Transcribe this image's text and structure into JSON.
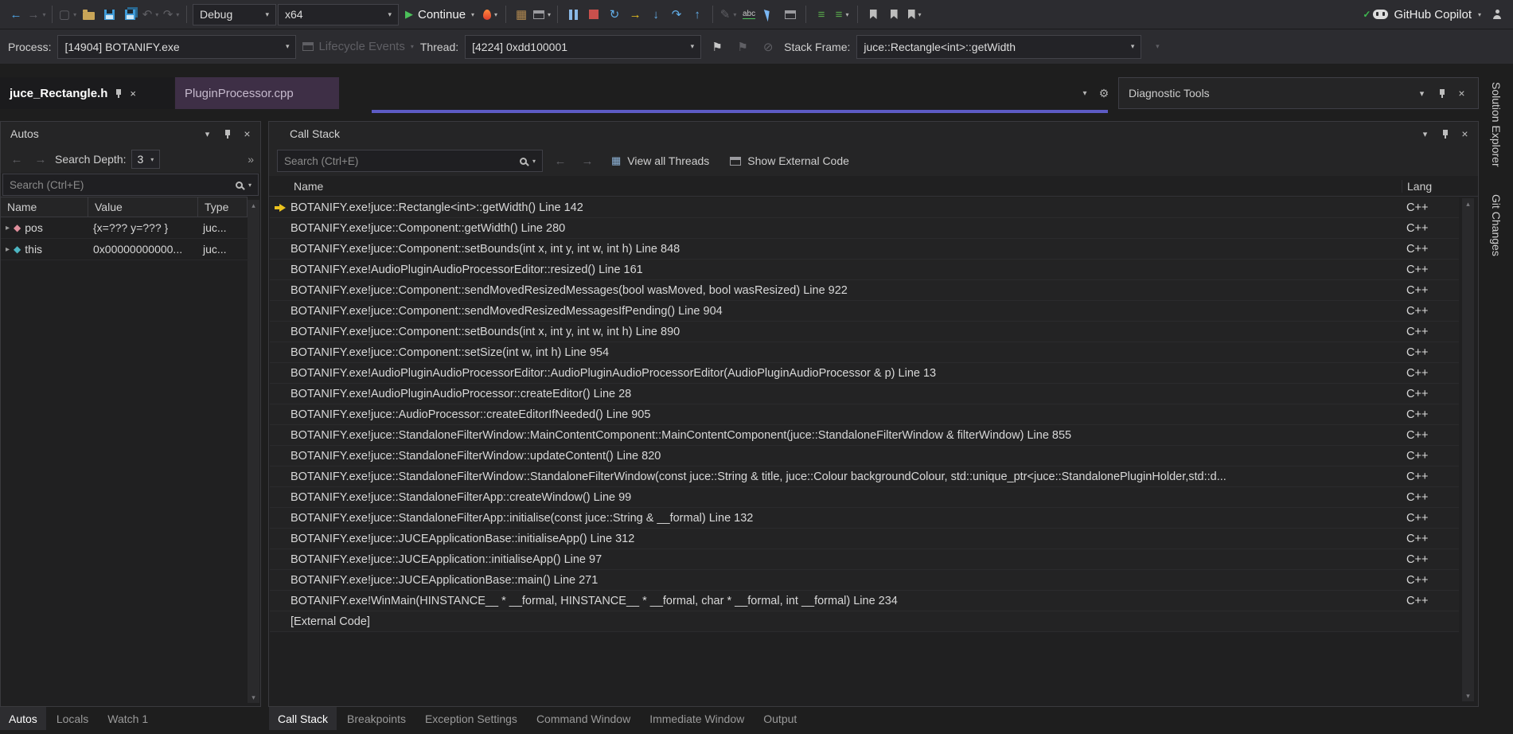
{
  "colors": {
    "current_statement_arrow": "#eac21e",
    "continue_green": "#4cc15a",
    "stop_red": "#c9504c",
    "hot_reload_flame": "#e6552e",
    "copilot_check_green": "#3fb950",
    "editor_scrollbar_purple": "#5d5bc4",
    "preview_tab_purple": "#3e2f46"
  },
  "toolbar": {
    "debug_config": "Debug",
    "platform": "x64",
    "continue_label": "Continue",
    "copilot_label": "GitHub Copilot"
  },
  "debug_location_bar": {
    "process_label": "Process:",
    "process_value": "[14904] BOTANIFY.exe",
    "lifecycle_events_label": "Lifecycle Events",
    "thread_label": "Thread:",
    "thread_value": "[4224] 0xdd100001",
    "stack_frame_label": "Stack Frame:",
    "stack_frame_value": "juce::Rectangle<int>::getWidth"
  },
  "document_tabs": [
    {
      "label": "juce_Rectangle.h",
      "active": true
    },
    {
      "label": "PluginProcessor.cpp",
      "active": false
    }
  ],
  "diagnostic_tools": {
    "title": "Diagnostic Tools"
  },
  "right_rail": [
    "Solution Explorer",
    "Git Changes"
  ],
  "autos_panel": {
    "title": "Autos",
    "search_depth_label": "Search Depth:",
    "search_depth_value": "3",
    "search_placeholder": "Search (Ctrl+E)",
    "columns": [
      "Name",
      "Value",
      "Type"
    ],
    "rows": [
      {
        "name": "pos",
        "value": "{x=??? y=??? }",
        "type": "juc...",
        "icon_color": "#e08f9c"
      },
      {
        "name": "this",
        "value": "0x00000000000...",
        "type": "juc...",
        "icon_color": "#4db6c2"
      }
    ],
    "bottom_tabs": [
      {
        "label": "Autos",
        "active": true
      },
      {
        "label": "Locals",
        "active": false
      },
      {
        "label": "Watch 1",
        "active": false
      }
    ]
  },
  "call_stack_panel": {
    "title": "Call Stack",
    "search_placeholder": "Search (Ctrl+E)",
    "view_all_threads_label": "View all Threads",
    "show_external_code_label": "Show External Code",
    "name_column": "Name",
    "lang_column": "Lang",
    "frames": [
      {
        "name": "BOTANIFY.exe!juce::Rectangle<int>::getWidth() Line 142",
        "lang": "C++",
        "current": true
      },
      {
        "name": "BOTANIFY.exe!juce::Component::getWidth() Line 280",
        "lang": "C++",
        "current": false
      },
      {
        "name": "BOTANIFY.exe!juce::Component::setBounds(int x, int y, int w, int h) Line 848",
        "lang": "C++",
        "current": false
      },
      {
        "name": "BOTANIFY.exe!AudioPluginAudioProcessorEditor::resized() Line 161",
        "lang": "C++",
        "current": false
      },
      {
        "name": "BOTANIFY.exe!juce::Component::sendMovedResizedMessages(bool wasMoved, bool wasResized) Line 922",
        "lang": "C++",
        "current": false
      },
      {
        "name": "BOTANIFY.exe!juce::Component::sendMovedResizedMessagesIfPending() Line 904",
        "lang": "C++",
        "current": false
      },
      {
        "name": "BOTANIFY.exe!juce::Component::setBounds(int x, int y, int w, int h) Line 890",
        "lang": "C++",
        "current": false
      },
      {
        "name": "BOTANIFY.exe!juce::Component::setSize(int w, int h) Line 954",
        "lang": "C++",
        "current": false
      },
      {
        "name": "BOTANIFY.exe!AudioPluginAudioProcessorEditor::AudioPluginAudioProcessorEditor(AudioPluginAudioProcessor & p) Line 13",
        "lang": "C++",
        "current": false
      },
      {
        "name": "BOTANIFY.exe!AudioPluginAudioProcessor::createEditor() Line 28",
        "lang": "C++",
        "current": false
      },
      {
        "name": "BOTANIFY.exe!juce::AudioProcessor::createEditorIfNeeded() Line 905",
        "lang": "C++",
        "current": false
      },
      {
        "name": "BOTANIFY.exe!juce::StandaloneFilterWindow::MainContentComponent::MainContentComponent(juce::StandaloneFilterWindow & filterWindow) Line 855",
        "lang": "C++",
        "current": false
      },
      {
        "name": "BOTANIFY.exe!juce::StandaloneFilterWindow::updateContent() Line 820",
        "lang": "C++",
        "current": false
      },
      {
        "name": "BOTANIFY.exe!juce::StandaloneFilterWindow::StandaloneFilterWindow(const juce::String & title, juce::Colour backgroundColour, std::unique_ptr<juce::StandalonePluginHolder,std::d...",
        "lang": "C++",
        "current": false
      },
      {
        "name": "BOTANIFY.exe!juce::StandaloneFilterApp::createWindow() Line 99",
        "lang": "C++",
        "current": false
      },
      {
        "name": "BOTANIFY.exe!juce::StandaloneFilterApp::initialise(const juce::String & __formal) Line 132",
        "lang": "C++",
        "current": false
      },
      {
        "name": "BOTANIFY.exe!juce::JUCEApplicationBase::initialiseApp() Line 312",
        "lang": "C++",
        "current": false
      },
      {
        "name": "BOTANIFY.exe!juce::JUCEApplication::initialiseApp() Line 97",
        "lang": "C++",
        "current": false
      },
      {
        "name": "BOTANIFY.exe!juce::JUCEApplicationBase::main() Line 271",
        "lang": "C++",
        "current": false
      },
      {
        "name": "BOTANIFY.exe!WinMain(HINSTANCE__ * __formal, HINSTANCE__ * __formal, char * __formal, int __formal) Line 234",
        "lang": "C++",
        "current": false
      },
      {
        "name": "[External Code]",
        "lang": "",
        "current": false
      }
    ],
    "bottom_tabs": [
      {
        "label": "Call Stack",
        "active": true
      },
      {
        "label": "Breakpoints",
        "active": false
      },
      {
        "label": "Exception Settings",
        "active": false
      },
      {
        "label": "Command Window",
        "active": false
      },
      {
        "label": "Immediate Window",
        "active": false
      },
      {
        "label": "Output",
        "active": false
      }
    ]
  }
}
